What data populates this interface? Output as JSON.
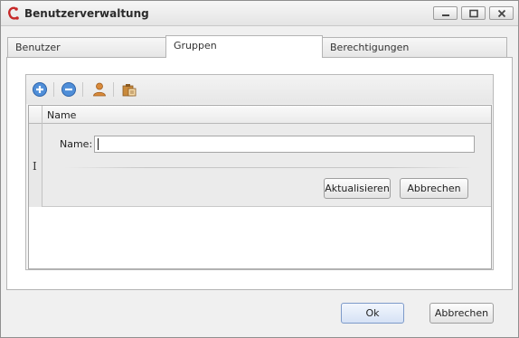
{
  "window": {
    "title": "Benutzerverwaltung"
  },
  "tabs": [
    {
      "label": "Benutzer"
    },
    {
      "label": "Gruppen"
    },
    {
      "label": "Berechtigungen"
    }
  ],
  "toolbar": {
    "icons": [
      "add-circle-icon",
      "remove-circle-icon",
      "user-icon",
      "clipboard-icon"
    ]
  },
  "grid": {
    "columns": [
      {
        "label": "Name"
      }
    ],
    "edit_form": {
      "name_label": "Name:",
      "name_value": "",
      "update_label": "Aktualisieren",
      "cancel_label": "Abbrechen"
    }
  },
  "footer": {
    "ok_label": "Ok",
    "cancel_label": "Abbrechen"
  },
  "colors": {
    "accent": "#2f6fc0",
    "app_icon": "#c62828"
  }
}
